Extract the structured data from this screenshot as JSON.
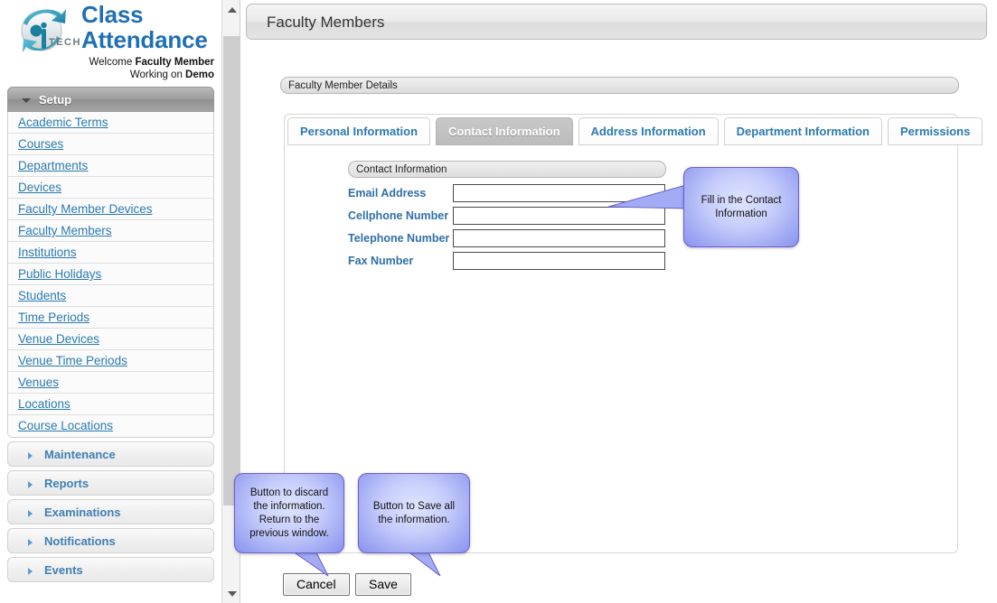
{
  "brand": {
    "title_line1": "Class",
    "title_line2": "Attendance",
    "logo_icon": "iptech-globe-logo",
    "logo_word": "TECH",
    "welcome_prefix": "Welcome ",
    "welcome_user": "Faculty Member",
    "working_prefix": "Working on ",
    "working_context": "Demo"
  },
  "sidebar": {
    "expanded_section": {
      "label": "Setup",
      "icon": "chevron-down-icon",
      "items": [
        {
          "label": "Academic Terms"
        },
        {
          "label": "Courses"
        },
        {
          "label": "Departments"
        },
        {
          "label": "Devices"
        },
        {
          "label": "Faculty Member Devices"
        },
        {
          "label": "Faculty Members"
        },
        {
          "label": "Institutions"
        },
        {
          "label": "Public Holidays"
        },
        {
          "label": "Students"
        },
        {
          "label": "Time Periods"
        },
        {
          "label": "Venue Devices"
        },
        {
          "label": "Venue Time Periods"
        },
        {
          "label": "Venues"
        },
        {
          "label": "Locations"
        },
        {
          "label": "Course Locations"
        }
      ]
    },
    "collapsed_sections": [
      {
        "label": "Maintenance",
        "icon": "chevron-right-icon"
      },
      {
        "label": "Reports",
        "icon": "chevron-right-icon"
      },
      {
        "label": "Examinations",
        "icon": "chevron-right-icon"
      },
      {
        "label": "Notifications",
        "icon": "chevron-right-icon"
      },
      {
        "label": "Events",
        "icon": "chevron-right-icon"
      }
    ],
    "scrollbar": {
      "up_icon": "chevron-up-icon",
      "down_icon": "chevron-down-icon"
    }
  },
  "header": {
    "title": "Faculty Members"
  },
  "details_panel": {
    "title": "Faculty Member Details"
  },
  "tabs": [
    {
      "label": "Personal Information",
      "active": false
    },
    {
      "label": "Contact Information",
      "active": true
    },
    {
      "label": "Address Information",
      "active": false
    },
    {
      "label": "Department Information",
      "active": false
    },
    {
      "label": "Permissions",
      "active": false
    }
  ],
  "form": {
    "legend": "Contact Information",
    "fields": [
      {
        "label": "Email Address",
        "value": "",
        "placeholder": ""
      },
      {
        "label": "Cellphone Number",
        "value": "",
        "placeholder": ""
      },
      {
        "label": "Telephone Number",
        "value": "",
        "placeholder": ""
      },
      {
        "label": "Fax Number",
        "value": "",
        "placeholder": ""
      }
    ]
  },
  "buttons": {
    "cancel": "Cancel",
    "save": "Save"
  },
  "callouts": {
    "contact": "Fill in the Contact Information",
    "cancel": "Button to discard the information. Return to the previous window.",
    "save": "Button to Save all the information."
  },
  "colors": {
    "brand_blue": "#1f6fb5",
    "link_blue": "#2a7ab0",
    "label_blue": "#2f6fa8",
    "callout_fill": "#9fa8f3",
    "callout_border": "#6a5fd0",
    "active_tab": "#c8c8c8"
  }
}
